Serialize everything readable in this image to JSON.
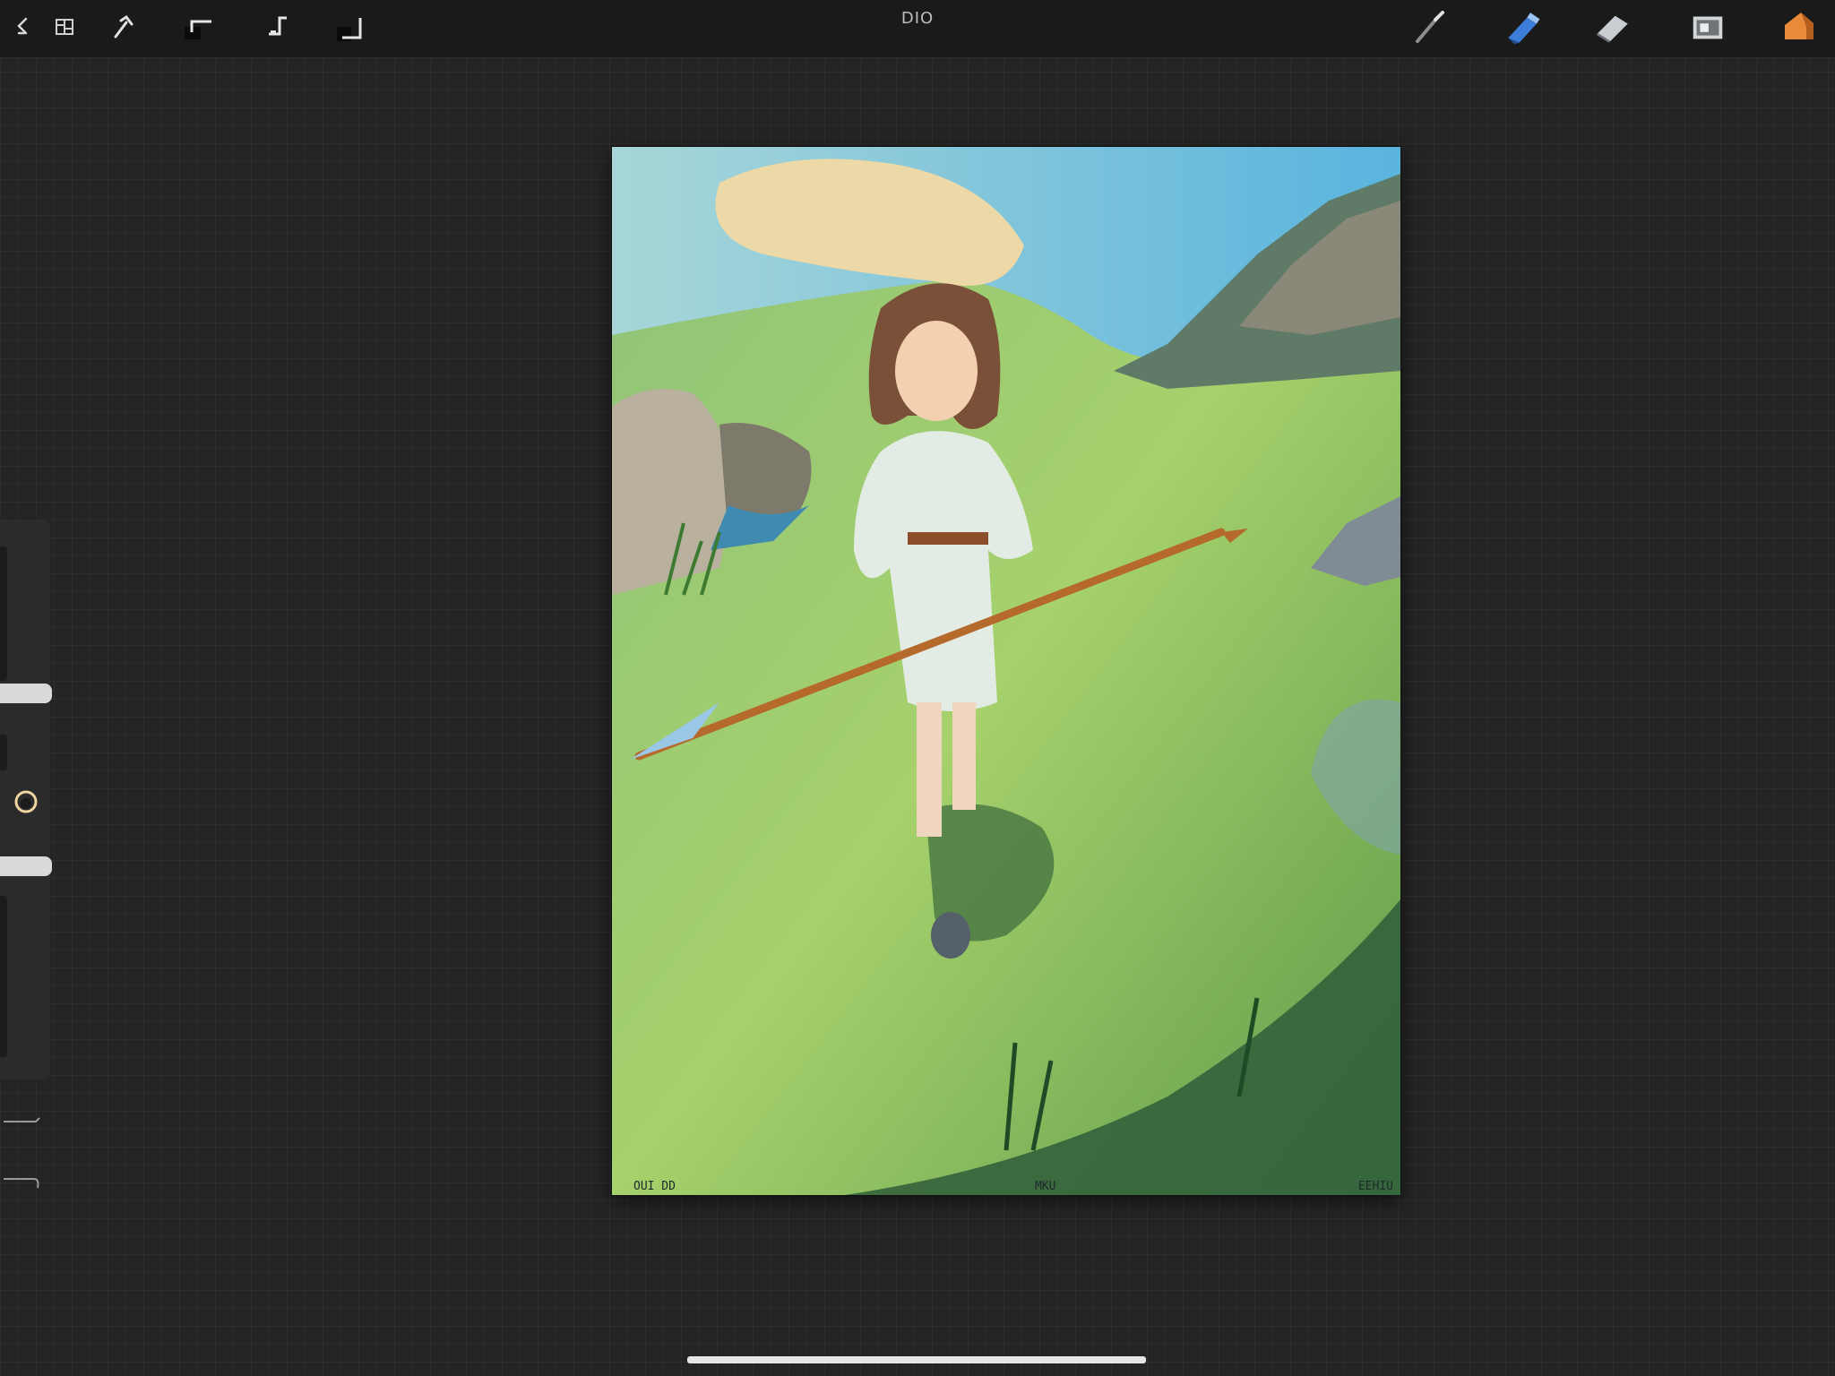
{
  "app": {
    "document_title": "DIO"
  },
  "toolbar_left": [
    {
      "name": "gallery-icon"
    },
    {
      "name": "actions-icon"
    },
    {
      "name": "adjustments-icon"
    },
    {
      "name": "selection-icon"
    },
    {
      "name": "transform-icon"
    },
    {
      "name": "crop-icon"
    }
  ],
  "toolbar_right": [
    {
      "name": "brush-icon"
    },
    {
      "name": "smudge-icon"
    },
    {
      "name": "eraser-icon"
    },
    {
      "name": "layers-icon"
    },
    {
      "name": "color-icon"
    }
  ],
  "colors": {
    "background": "#242424",
    "topbar": "#1a1a1a",
    "panel": "#2b2b2b",
    "accent_blue": "#3b7dd8",
    "color_swatch": "#e88a3a"
  },
  "canvas": {
    "caption_left": "OUI DD",
    "caption_mid": "MKU",
    "caption_right": "EEHIU"
  }
}
